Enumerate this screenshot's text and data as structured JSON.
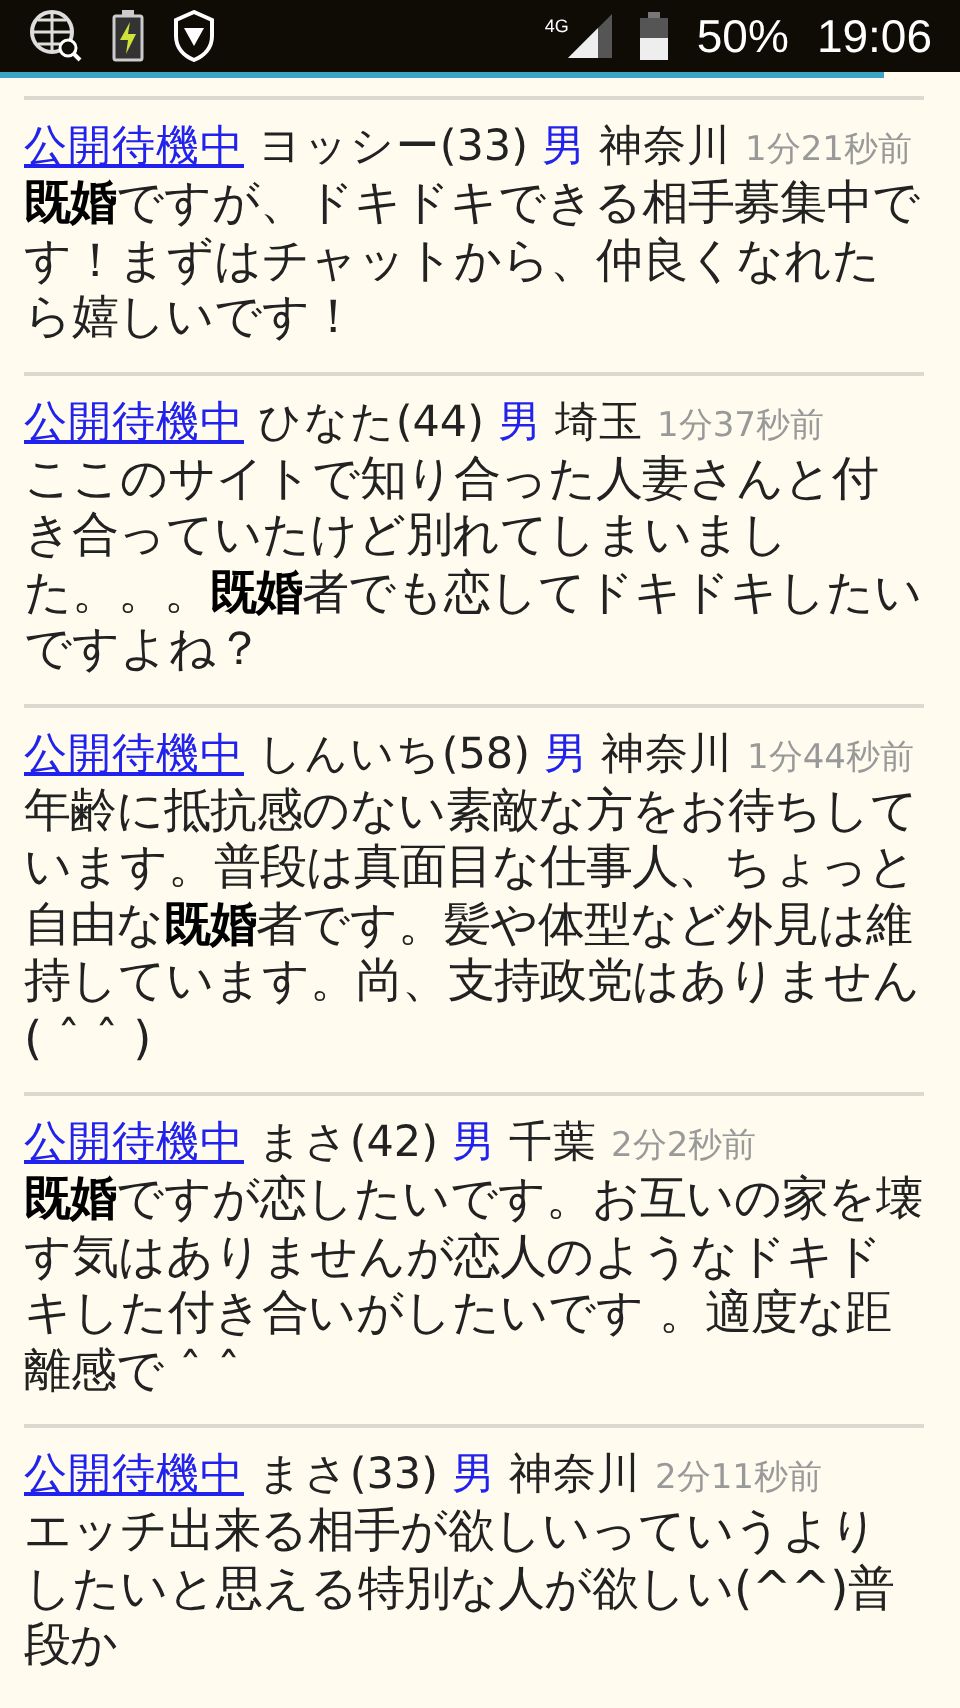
{
  "status_bar": {
    "network": "4G",
    "battery": "50%",
    "time": "19:06"
  },
  "load_progress": {
    "level": 0.92
  },
  "posts": [
    {
      "status_link": "公開待機中",
      "name": "ヨッシー(33)",
      "gender": "男",
      "region": "神奈川",
      "time": "1分21秒前",
      "body": "**既婚**ですが、ドキドキできる相手募集中です！まずはチャットから、仲良くなれたら嬉しいです！"
    },
    {
      "status_link": "公開待機中",
      "name": "ひなた(44)",
      "gender": "男",
      "region": "埼玉",
      "time": "1分37秒前",
      "body": "ここのサイトで知り合った人妻さんと付き合っていたけど別れてしまいました。。。**既婚**者でも恋してドキドキしたいですよね？"
    },
    {
      "status_link": "公開待機中",
      "name": "しんいち(58)",
      "gender": "男",
      "region": "神奈川",
      "time": "1分44秒前",
      "body": "年齢に抵抗感のない素敵な方をお待ちしています。普段は真面目な仕事人、ちょっと自由な**既婚**者です。髪や体型など外見は維持しています。尚、支持政党はありません( ˆ ˆ )"
    },
    {
      "status_link": "公開待機中",
      "name": "まさ(42)",
      "gender": "男",
      "region": "千葉",
      "time": "2分2秒前",
      "body": "**既婚**ですが恋したいです。お互いの家を壊す気はありませんが恋人のようなドキドキした付き合いがしたいです 。適度な距離感で ˆ ˆ"
    },
    {
      "status_link": "公開待機中",
      "name": "まさ(33)",
      "gender": "男",
      "region": "神奈川",
      "time": "2分11秒前",
      "body": "エッチ出来る相手が欲しいっていうよりしたいと思える特別な人が欲しい(^^)普段か"
    }
  ]
}
